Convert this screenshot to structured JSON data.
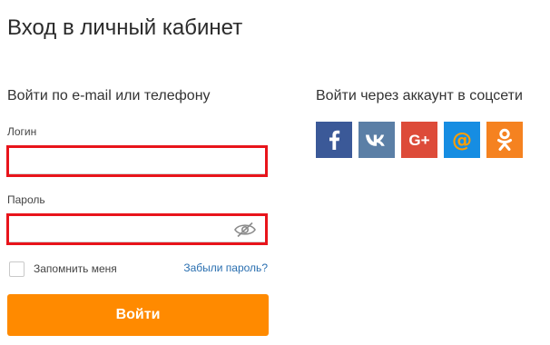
{
  "page": {
    "title": "Вход в личный кабинет"
  },
  "login_form": {
    "heading": "Войти по e-mail или телефону",
    "login_label": "Логин",
    "login_value": "",
    "password_label": "Пароль",
    "password_value": "",
    "remember_label": "Запомнить меня",
    "remember_checked": false,
    "forgot_link": "Забыли пароль?",
    "submit_label": "Войти",
    "highlight_color": "#e8141b",
    "link_color": "#2a6fb0",
    "submit_color": "#ff8a00"
  },
  "social": {
    "heading": "Войти через аккаунт в соцсети",
    "networks": [
      {
        "name": "facebook",
        "icon": "facebook-icon",
        "color": "#3b5998"
      },
      {
        "name": "vkontakte",
        "icon": "vk-icon",
        "color": "#5b7fa6"
      },
      {
        "name": "google-plus",
        "icon": "google-plus-icon",
        "color": "#dd4b39"
      },
      {
        "name": "mail-ru",
        "icon": "mail-ru-icon",
        "color": "#168de2"
      },
      {
        "name": "odnoklassniki",
        "icon": "odnoklassniki-icon",
        "color": "#f58220"
      }
    ]
  }
}
